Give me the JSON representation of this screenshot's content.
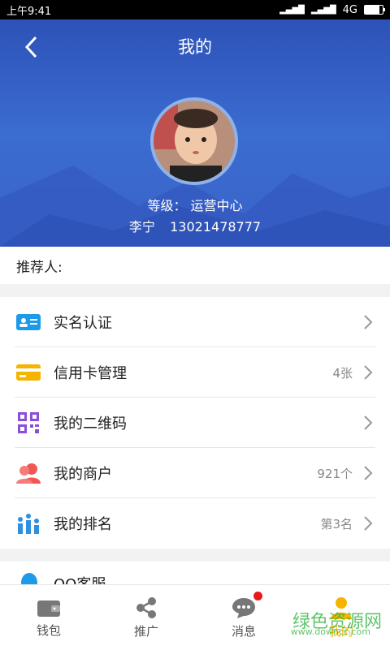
{
  "status": {
    "time": "上午9:41",
    "network": "4G"
  },
  "header": {
    "title": "我的",
    "level_label": "等级：",
    "level_value": "运营中心",
    "name": "李宁",
    "phone": "13021478777"
  },
  "referrer": {
    "label": "推荐人:"
  },
  "menu": [
    {
      "label": "实名认证",
      "value": ""
    },
    {
      "label": "信用卡管理",
      "value": "4张"
    },
    {
      "label": "我的二维码",
      "value": ""
    },
    {
      "label": "我的商户",
      "value": "921个"
    },
    {
      "label": "我的排名",
      "value": "第3名"
    }
  ],
  "partial_item": {
    "label": "QQ客服"
  },
  "tabs": [
    {
      "label": "钱包"
    },
    {
      "label": "推广"
    },
    {
      "label": "消息"
    },
    {
      "label": "我的"
    }
  ],
  "watermark": {
    "text": "绿色资源网",
    "site": "www.downcc.com"
  },
  "colors": {
    "header_blue": "#3a63c9",
    "active_tab": "#f5b400",
    "badge": "#e81919"
  }
}
